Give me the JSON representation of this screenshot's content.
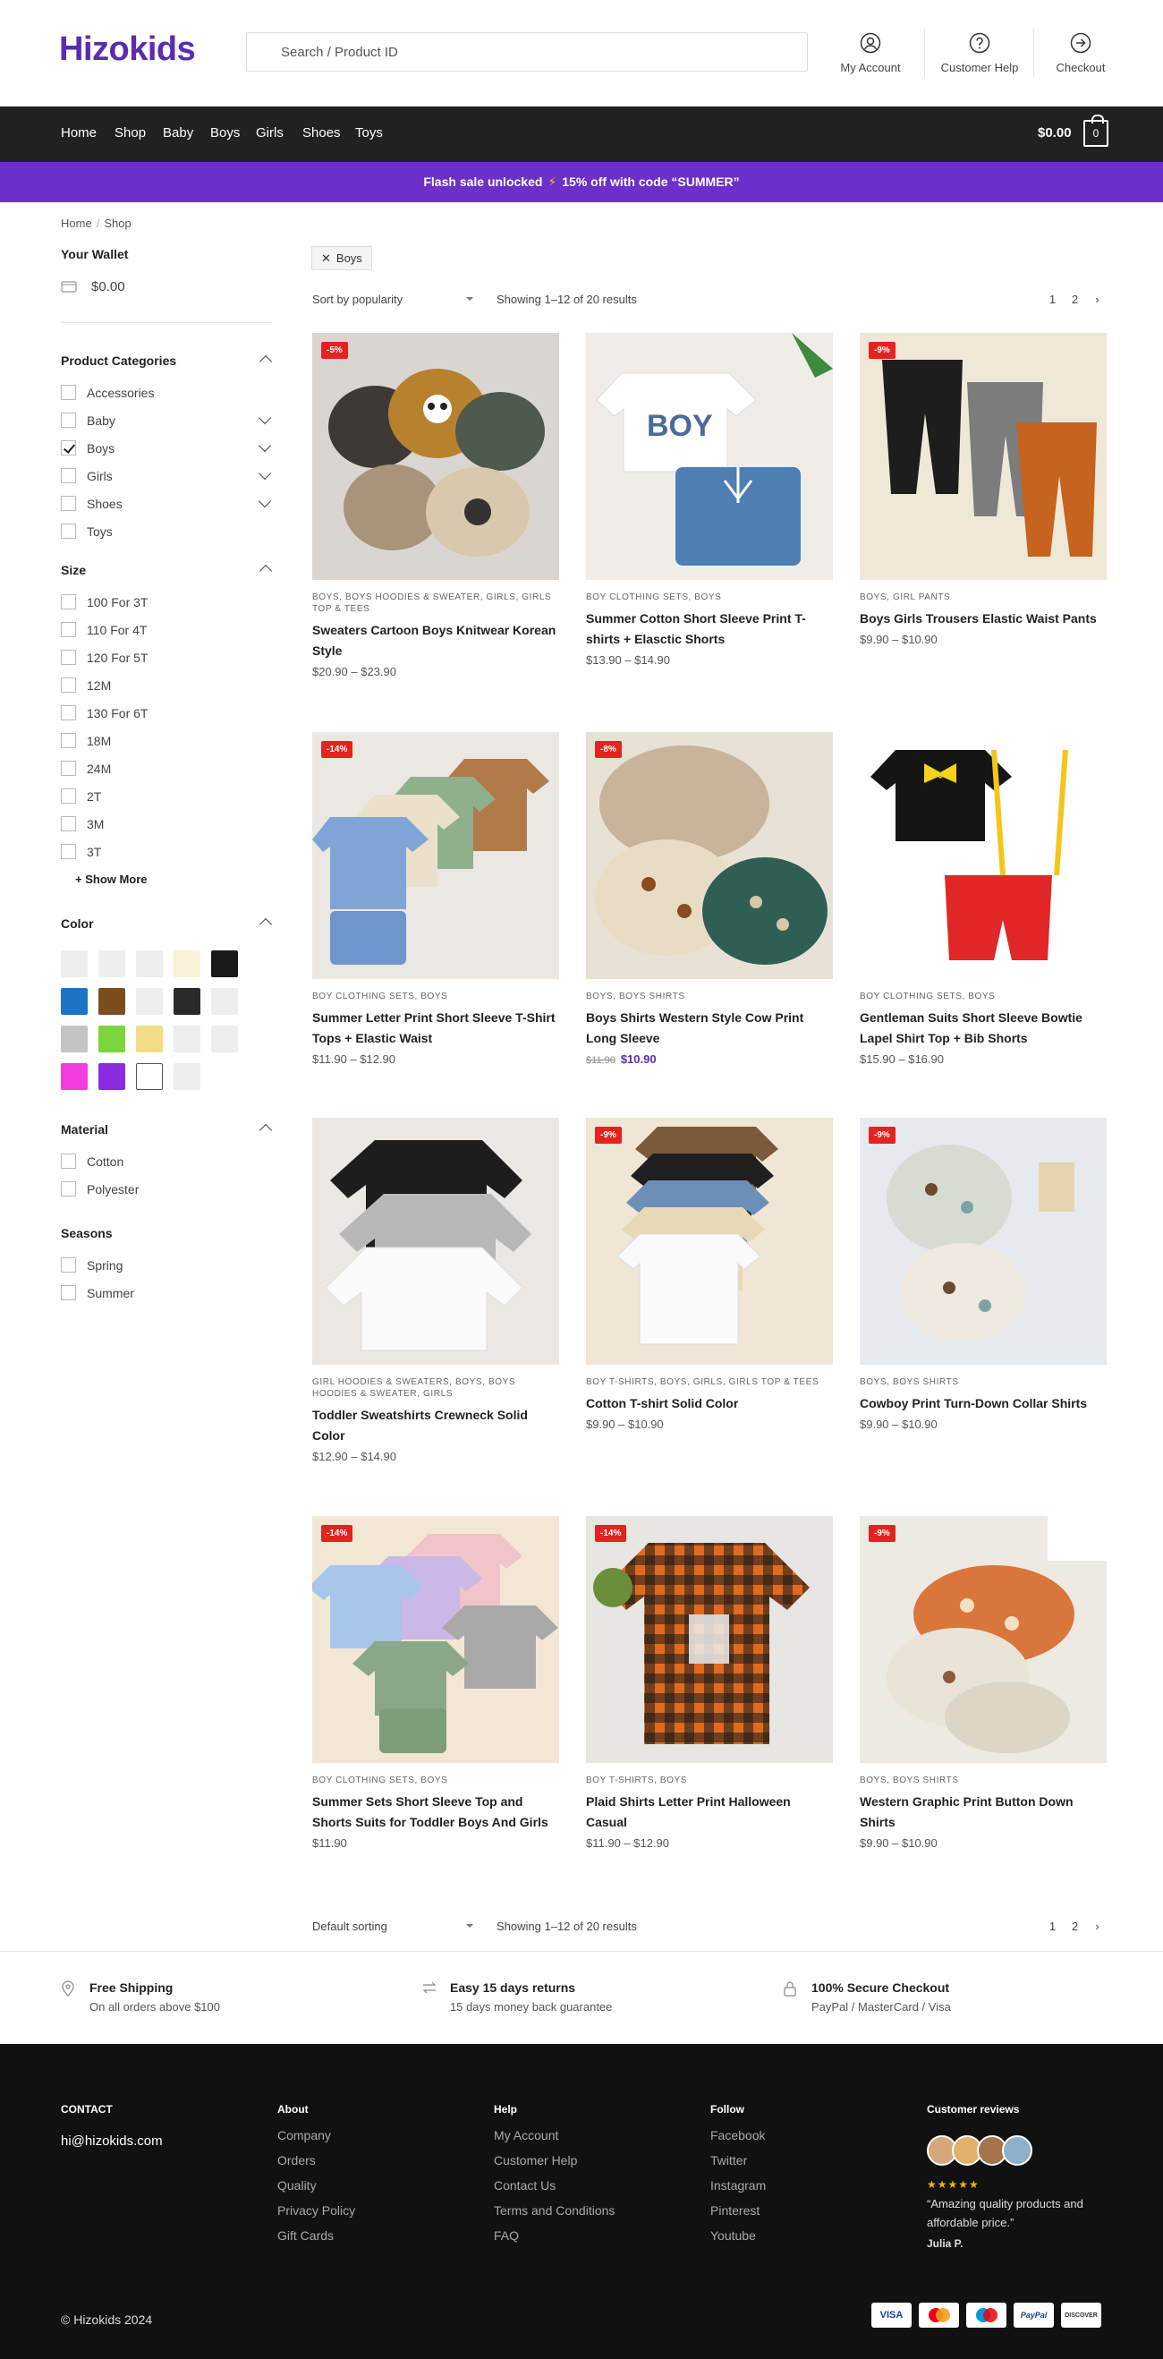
{
  "header": {
    "logo": "Hizokids",
    "search_placeholder": "Search / Product ID",
    "links": [
      {
        "label": "My Account",
        "icon": "user-icon"
      },
      {
        "label": "Customer Help",
        "icon": "help-icon"
      },
      {
        "label": "Checkout",
        "icon": "arrow-right-circle-icon"
      }
    ]
  },
  "nav": {
    "items": [
      "Home",
      "Shop",
      "Baby",
      "Boys",
      "Girls",
      "Shoes",
      "Toys"
    ],
    "cart_total": "$0.00",
    "cart_count": "0"
  },
  "promo": {
    "text_before": "Flash sale unlocked",
    "bolt": "⚡",
    "text_after": "15% off with code “SUMMER”"
  },
  "breadcrumb": {
    "home": "Home",
    "current": "Shop"
  },
  "sidebar": {
    "wallet_title": "Your Wallet",
    "wallet_amount": "$0.00",
    "categories": {
      "title": "Product Categories",
      "items": [
        {
          "label": "Accessories",
          "checked": false,
          "expandable": false
        },
        {
          "label": "Baby",
          "checked": false,
          "expandable": true
        },
        {
          "label": "Boys",
          "checked": true,
          "expandable": true
        },
        {
          "label": "Girls",
          "checked": false,
          "expandable": true
        },
        {
          "label": "Shoes",
          "checked": false,
          "expandable": true
        },
        {
          "label": "Toys",
          "checked": false,
          "expandable": false
        }
      ]
    },
    "size": {
      "title": "Size",
      "items": [
        "100 For 3T",
        "110 For 4T",
        "120 For 5T",
        "12M",
        "130 For 6T",
        "18M",
        "24M",
        "2T",
        "3M",
        "3T"
      ],
      "show_more": "+ Show More"
    },
    "color": {
      "title": "Color",
      "swatches": [
        "#eeeeee",
        "#eeeeee",
        "#eeeeee",
        "#f8f3d8",
        "#1a1a1a",
        "#1f73c4",
        "#7a4e1f",
        "#eeeeee",
        "#2a2a2a",
        "#eeeeee",
        "#c4c4c4",
        "#7bd63e",
        "#f2dc86",
        "#eeeeee",
        "#eeeeee",
        "#f33ce0",
        "#8a2be2",
        "#ffffff",
        "#eeeeee"
      ]
    },
    "material": {
      "title": "Material",
      "items": [
        "Cotton",
        "Polyester"
      ]
    },
    "seasons": {
      "title": "Seasons",
      "items": [
        "Spring",
        "Summer"
      ]
    }
  },
  "toolbar": {
    "filter_chip": "Boys",
    "sort_top": "Sort by popularity",
    "sort_bottom": "Default sorting",
    "result_count": "Showing 1–12 of 20 results",
    "pages": [
      "1",
      "2",
      "›"
    ]
  },
  "products": [
    {
      "badge": "-5%",
      "cat": "BOYS, BOYS HOODIES & SWEATER, GIRLS, GIRLS TOP & TEES",
      "title": "Sweaters Cartoon Boys Knitwear Korean Style",
      "price": "$20.90 – $23.90"
    },
    {
      "badge": "",
      "cat": "BOY CLOTHING SETS, BOYS",
      "title": "Summer Cotton Short Sleeve Print T-shirts + Elasctic Shorts",
      "price": "$13.90 – $14.90"
    },
    {
      "badge": "-9%",
      "cat": "BOYS, GIRL PANTS",
      "title": "Boys Girls Trousers Elastic Waist Pants",
      "price": "$9.90 – $10.90"
    },
    {
      "badge": "-14%",
      "cat": "BOY CLOTHING SETS, BOYS",
      "title": "Summer Letter Print Short Sleeve T-Shirt Tops + Elastic Waist",
      "price": "$11.90 – $12.90"
    },
    {
      "badge": "-8%",
      "cat": "BOYS, BOYS SHIRTS",
      "title": "Boys Shirts Western Style Cow Print Long Sleeve",
      "old_price": "$11.90",
      "new_price": "$10.90"
    },
    {
      "badge": "",
      "cat": "BOY CLOTHING SETS, BOYS",
      "title": "Gentleman Suits Short Sleeve Bowtie Lapel Shirt Top + Bib Shorts",
      "price": "$15.90 – $16.90"
    },
    {
      "badge": "",
      "cat": "GIRL HOODIES & SWEATERS, BOYS, BOYS HOODIES & SWEATER, GIRLS",
      "title": "Toddler Sweatshirts Crewneck Solid Color",
      "price": "$12.90 – $14.90"
    },
    {
      "badge": "-9%",
      "cat": "BOY T-SHIRTS, BOYS, GIRLS, GIRLS TOP & TEES",
      "title": "Cotton T-shirt Solid Color",
      "price": "$9.90 – $10.90"
    },
    {
      "badge": "-9%",
      "cat": "BOYS, BOYS SHIRTS",
      "title": "Cowboy Print Turn-Down Collar Shirts",
      "price": "$9.90 – $10.90"
    },
    {
      "badge": "-14%",
      "cat": "BOY CLOTHING SETS, BOYS",
      "title": "Summer Sets Short Sleeve Top and Shorts Suits for Toddler Boys And Girls",
      "price": "$11.90"
    },
    {
      "badge": "-14%",
      "cat": "BOY T-SHIRTS, BOYS",
      "title": "Plaid Shirts Letter Print Halloween Casual",
      "price": "$11.90 – $12.90"
    },
    {
      "badge": "-9%",
      "cat": "BOYS, BOYS SHIRTS",
      "title": "Western Graphic Print Button Down Shirts",
      "price": "$9.90 – $10.90"
    }
  ],
  "features": [
    {
      "title": "Free Shipping",
      "sub": "On all orders above $100",
      "icon": "location-pin-icon"
    },
    {
      "title": "Easy 15 days returns",
      "sub": "15 days money back guarantee",
      "icon": "return-arrows-icon"
    },
    {
      "title": "100% Secure Checkout",
      "sub": "PayPal / MasterCard / Visa",
      "icon": "lock-icon"
    }
  ],
  "footer": {
    "contact_title": "CONTACT",
    "email": "hi@hizokids.com",
    "about": {
      "title": "About",
      "links": [
        "Company",
        "Orders",
        "Quality",
        "Privacy Policy",
        "Gift Cards"
      ]
    },
    "help": {
      "title": "Help",
      "links": [
        "My Account",
        "Customer Help",
        "Contact Us",
        "Terms and Conditions",
        "FAQ"
      ]
    },
    "follow": {
      "title": "Follow",
      "links": [
        "Facebook",
        "Twitter",
        "Instagram",
        "Pinterest",
        "Youtube"
      ]
    },
    "reviews": {
      "title": "Customer reviews",
      "stars": "★★★★★",
      "quote": "“Amazing quality products and affordable price.”",
      "author": "Julia P."
    },
    "copyright": "© Hizokids 2024",
    "payments": [
      "VISA",
      "MC",
      "MAESTRO",
      "PayPal",
      "DISCOVER"
    ]
  }
}
